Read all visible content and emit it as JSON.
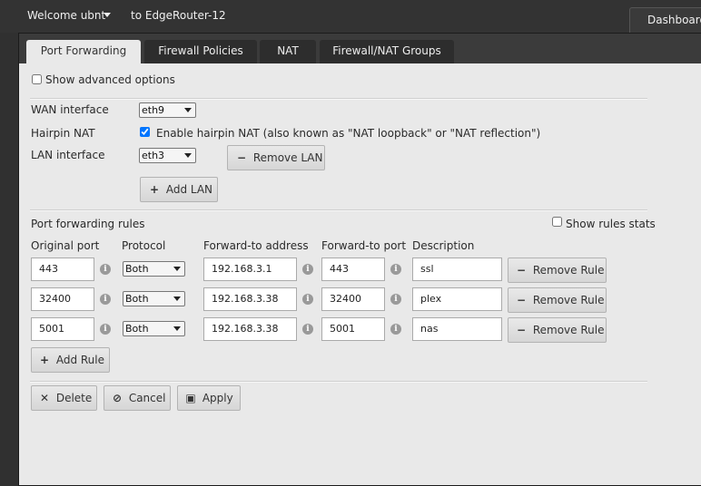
{
  "topbar": {
    "welcome": "Welcome ubnt",
    "device": "to EdgeRouter-12",
    "dashboard_tab": "Dashboard"
  },
  "tabs": [
    "Port Forwarding",
    "Firewall Policies",
    "NAT",
    "Firewall/NAT Groups"
  ],
  "options": {
    "show_advanced": "Show advanced options"
  },
  "interfaces": {
    "wan_label": "WAN interface",
    "wan_value": "eth9",
    "hairpin_label": "Hairpin NAT",
    "hairpin_text": "Enable hairpin NAT (also known as \"NAT loopback\" or \"NAT reflection\")",
    "lan_label": "LAN interface",
    "lan_value": "eth3",
    "remove_lan": "Remove LAN",
    "add_lan": "Add LAN"
  },
  "rules": {
    "title": "Port forwarding rules",
    "show_stats": "Show rules stats",
    "headers": [
      "Original port",
      "Protocol",
      "Forward-to address",
      "Forward-to port",
      "Description"
    ],
    "rows": [
      {
        "port": "443",
        "protocol": "Both",
        "address": "192.168.3.1",
        "fport": "443",
        "desc": "ssl"
      },
      {
        "port": "32400",
        "protocol": "Both",
        "address": "192.168.3.38",
        "fport": "32400",
        "desc": "plex"
      },
      {
        "port": "5001",
        "protocol": "Both",
        "address": "192.168.3.38",
        "fport": "5001",
        "desc": "nas"
      }
    ],
    "remove_rule": "Remove Rule",
    "add_rule": "Add Rule"
  },
  "actions": {
    "delete": "Delete",
    "cancel": "Cancel",
    "apply": "Apply"
  },
  "colors": {
    "topbar": "#333333",
    "panel": "#e9e9e9",
    "tab_dark": "#2d2d2d"
  }
}
